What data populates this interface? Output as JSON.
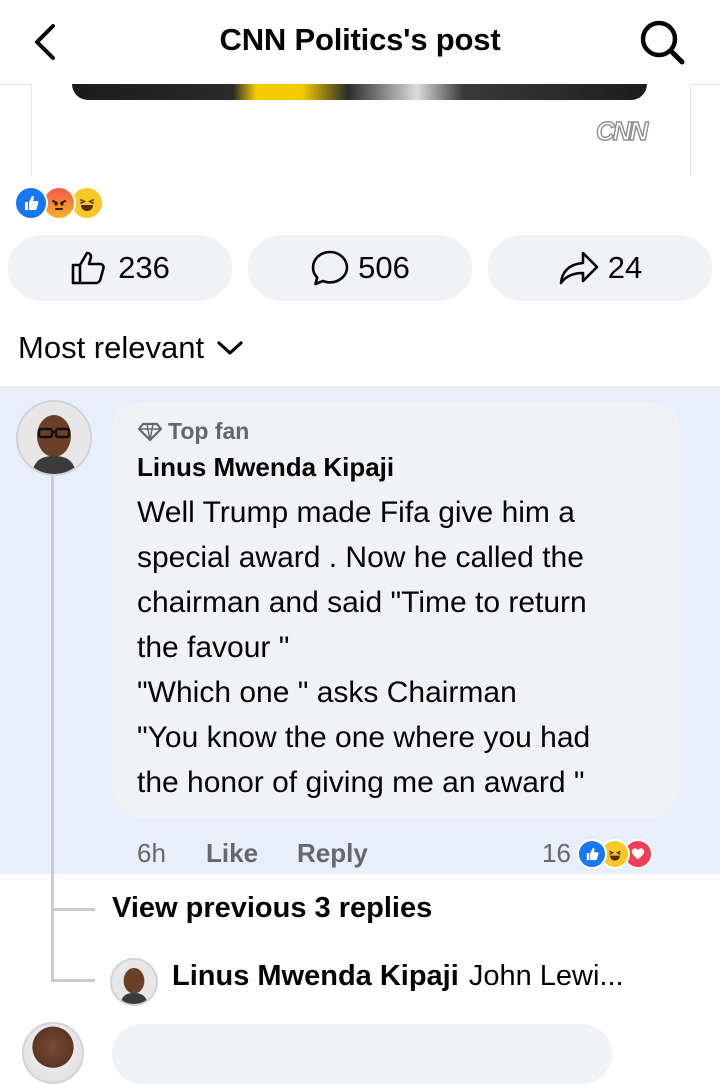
{
  "header": {
    "title": "CNN Politics's post"
  },
  "media": {
    "source_logo": "CNN"
  },
  "reactions": {
    "icons": [
      "like",
      "angry",
      "haha"
    ]
  },
  "actions": {
    "like_count": "236",
    "comment_count": "506",
    "share_count": "24"
  },
  "sort": {
    "label": "Most relevant"
  },
  "comment": {
    "badge": "Top fan",
    "author": "Linus Mwenda Kipaji",
    "text": "Well Trump made Fifa give him a\nspecial award . Now he called the\nchairman  and said \"Time to return\nthe favour \"\n\"Which one \" asks Chairman\n\"You know the one where you had\nthe honor of giving me an award \"",
    "time": "6h",
    "like_label": "Like",
    "reply_label": "Reply",
    "reaction_count": "16"
  },
  "replies": {
    "view_previous": "View previous 3 replies",
    "last_reply": {
      "author": "Linus Mwenda Kipaji",
      "snippet": "John Lewi..."
    }
  },
  "colors": {
    "accent": "#1877f2",
    "highlight_bg": "#e6effa",
    "pill_bg": "#f0f2f5",
    "muted_text": "#65676b"
  }
}
